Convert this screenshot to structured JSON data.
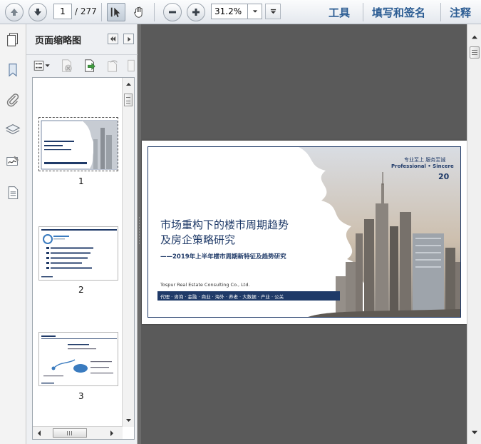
{
  "toolbar": {
    "current_page": "1",
    "total_pages": "/ 277",
    "zoom": "31.2%",
    "tools_label": "工具",
    "sign_label": "填写和签名",
    "comment_label": "注释"
  },
  "panel": {
    "title": "页面缩略图",
    "thumbnails": [
      {
        "label": "1"
      },
      {
        "label": "2"
      },
      {
        "label": "3"
      }
    ]
  },
  "slide": {
    "title_line1": "市场重构下的楼市周期趋势",
    "title_line2": "及房企策略研究",
    "subtitle": "——2019年上半年楼市周期新特征及趋势研究",
    "company": "Tospur Real Estate Consulting Co., Ltd.",
    "services": "代理 · 咨询 · 金融 · 商业 · 海外 · 养老 · 大数据 · 产业 · 公关",
    "slogan_cn": "专业至上  服务至诚",
    "slogan_en": "Professional • Sincere",
    "logo": "20"
  },
  "colors": {
    "brand_navy": "#1f3a68",
    "doc_background": "#5a5a5a",
    "toolbar_link": "#2b5c93"
  },
  "icons": [
    "up-arrow-icon",
    "down-arrow-icon",
    "select-cursor-icon",
    "hand-icon",
    "zoom-out-icon",
    "zoom-in-icon",
    "chevron-down-icon",
    "pages-icon",
    "bookmark-icon",
    "paperclip-icon",
    "layers-icon",
    "signature-icon",
    "document-icon"
  ]
}
